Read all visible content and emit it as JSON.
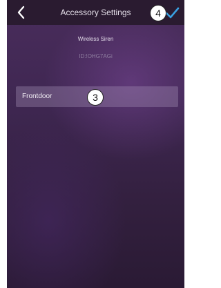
{
  "header": {
    "title": "Accessory Settings",
    "back_icon": "chevron-left-icon",
    "confirm_icon": "checkmark-icon",
    "confirm_color": "#39a0e0"
  },
  "device": {
    "name": "Wireless Siren",
    "id": "ID:!OHG7AGi"
  },
  "name_field": {
    "value": "Frontdoor"
  },
  "callouts": {
    "confirm": "4",
    "name_field": "3"
  },
  "colors": {
    "header_bg": "#2a1b30",
    "background_top": "#4a2d5c",
    "background_bottom": "#2a1a34"
  }
}
